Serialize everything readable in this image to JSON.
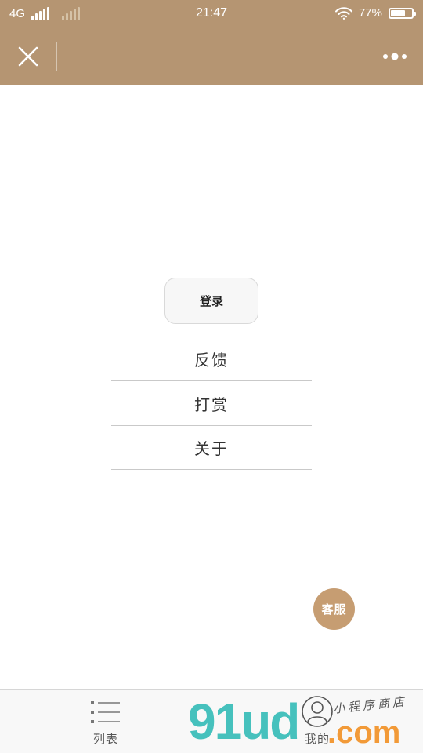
{
  "status_bar": {
    "network": "4G",
    "time": "21:47",
    "battery_percent": "77%",
    "battery_level": 0.77
  },
  "nav": {
    "close_icon": "close-icon",
    "more_icon": "more-dots-icon"
  },
  "menu": {
    "login_label": "登录",
    "items": [
      {
        "label": "反馈"
      },
      {
        "label": "打赏"
      },
      {
        "label": "关于"
      }
    ]
  },
  "service_button": {
    "label": "客服",
    "color": "#c69d72"
  },
  "tabbar": {
    "tabs": [
      {
        "label": "列表",
        "icon": "list-icon"
      },
      {
        "label": "我的",
        "icon": "user-icon"
      }
    ]
  },
  "watermark": {
    "logo": "91ud",
    "suffix": ".com",
    "tagline": "小程序商店"
  },
  "colors": {
    "header_bg": "#b59572",
    "accent": "#c69d72"
  }
}
